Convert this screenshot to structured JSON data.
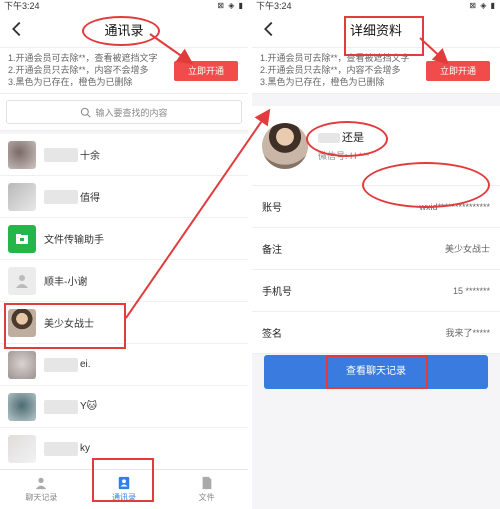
{
  "left": {
    "status": {
      "time": "下午3:24",
      "icons": "⊠ ◈ ▮"
    },
    "title": "通讯录",
    "promo": {
      "lines": [
        "1.开通会员可去除**，查看被遮挡文字",
        "2.开通会员只去除**，内容不会增多",
        "3.黑色为已存在，橙色为已删除"
      ],
      "button": "立即开通"
    },
    "search_placeholder": "输入要查找的内容",
    "contacts": [
      {
        "name": "十余"
      },
      {
        "name": "值得"
      },
      {
        "name": "文件传输助手"
      },
      {
        "name": "顺丰-小谢"
      },
      {
        "name": "美少女战士"
      },
      {
        "name": "ei."
      },
      {
        "name": "Y🐱"
      },
      {
        "name": "ky"
      }
    ],
    "tabs": [
      "聊天记录",
      "通讯录",
      "文件"
    ]
  },
  "right": {
    "status": {
      "time": "下午3:24",
      "icons": "⊠ ◈ ▮"
    },
    "title": "详细资料",
    "promo": {
      "lines": [
        "1.开通会员可去除**，查看被遮挡文字",
        "2.开通会员只去除**，内容不会增多",
        "3.黑色为已存在，橙色为已删除"
      ],
      "button": "立即开通"
    },
    "profile": {
      "name": "还是",
      "wechat_id": "微信号: H   ***"
    },
    "fields": [
      {
        "label": "账号",
        "value": "wxid***************"
      },
      {
        "label": "备注",
        "value": "美少女战士"
      },
      {
        "label": "手机号",
        "value": "15      *******"
      },
      {
        "label": "签名",
        "value": "我来了*****"
      }
    ],
    "chat_button": "查看聊天记录"
  },
  "colors": {
    "annotation": "#e23b3b",
    "accent": "#3a7be0",
    "promo_button": "#f24b4b"
  }
}
